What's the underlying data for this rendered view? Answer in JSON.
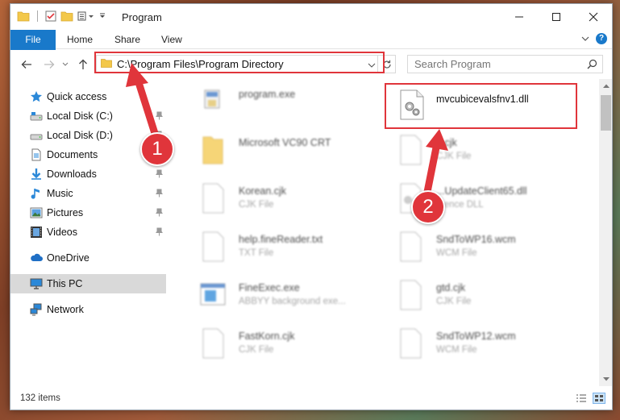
{
  "window": {
    "title": "Program",
    "controls": {
      "minimize": "minimize-icon",
      "maximize": "maximize-icon",
      "close": "close-icon"
    }
  },
  "ribbon": {
    "tabs": [
      {
        "label": "File",
        "active": true
      },
      {
        "label": "Home"
      },
      {
        "label": "Share"
      },
      {
        "label": "View"
      }
    ]
  },
  "address": {
    "path": "C:\\Program Files\\Program Directory",
    "search_placeholder": "Search Program"
  },
  "sidebar": {
    "items": [
      {
        "label": "Quick access",
        "icon": "star-icon",
        "pinned": false
      },
      {
        "label": "Local Disk (C:)",
        "icon": "drive-icon",
        "pinned": true
      },
      {
        "label": "Local Disk (D:)",
        "icon": "drive-icon",
        "pinned": true
      },
      {
        "label": "Documents",
        "icon": "documents-icon",
        "pinned": true
      },
      {
        "label": "Downloads",
        "icon": "download-icon",
        "pinned": true
      },
      {
        "label": "Music",
        "icon": "music-icon",
        "pinned": true
      },
      {
        "label": "Pictures",
        "icon": "pictures-icon",
        "pinned": true
      },
      {
        "label": "Videos",
        "icon": "videos-icon",
        "pinned": true
      },
      {
        "label": "OneDrive",
        "icon": "cloud-icon",
        "pinned": false
      },
      {
        "label": "This PC",
        "icon": "computer-icon",
        "pinned": false,
        "selected": true
      },
      {
        "label": "Network",
        "icon": "network-icon",
        "pinned": false
      }
    ]
  },
  "files": [
    {
      "name": "program.exe",
      "type": "",
      "icon": "exe-icon"
    },
    {
      "name": "mvcubicevalsfnv1.dll",
      "type": "",
      "icon": "dll-gear-icon"
    },
    {
      "name": "Microsoft VC90 CRT",
      "type": "",
      "icon": "folder-icon"
    },
    {
      "name": "...cjk",
      "type": "CJK File",
      "icon": "blank-file-icon"
    },
    {
      "name": "Korean.cjk",
      "type": "CJK File",
      "icon": "blank-file-icon"
    },
    {
      "name": "...UpdateClient65.dll",
      "type": "...ence DLL",
      "icon": "dll-gear-icon"
    },
    {
      "name": "help.fineReader.txt",
      "type": "TXT File",
      "icon": "blank-file-icon"
    },
    {
      "name": "SndToWP16.wcm",
      "type": "WCM File",
      "icon": "blank-file-icon"
    },
    {
      "name": "FineExec.exe",
      "type": "ABBYY background exe...",
      "icon": "exe-window-icon"
    },
    {
      "name": "gtd.cjk",
      "type": "CJK File",
      "icon": "blank-file-icon"
    },
    {
      "name": "FastKorn.cjk",
      "type": "CJK File",
      "icon": "blank-file-icon"
    },
    {
      "name": "SndToWP12.wcm",
      "type": "WCM File",
      "icon": "blank-file-icon"
    }
  ],
  "status": {
    "item_count": "132 items"
  },
  "annotations": {
    "badge_1": "1",
    "badge_2": "2",
    "highlight_color": "#e0353b"
  }
}
